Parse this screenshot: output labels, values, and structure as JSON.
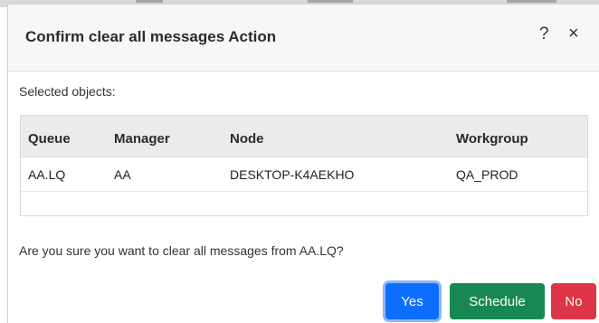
{
  "dialog": {
    "title": "Confirm clear all messages Action",
    "help_icon": "?",
    "close_icon": "×"
  },
  "selected_label": "Selected objects:",
  "table": {
    "headers": [
      "Queue",
      "Manager",
      "Node",
      "Workgroup"
    ],
    "rows": [
      [
        "AA.LQ",
        "AA",
        "DESKTOP-K4AEKHO",
        "QA_PROD"
      ]
    ]
  },
  "question": "Are you sure you want to clear all messages from AA.LQ?",
  "buttons": {
    "yes": "Yes",
    "schedule": "Schedule",
    "no": "No"
  },
  "colors": {
    "yes": "#0d6efd",
    "schedule": "#198754",
    "no": "#dc3545"
  }
}
